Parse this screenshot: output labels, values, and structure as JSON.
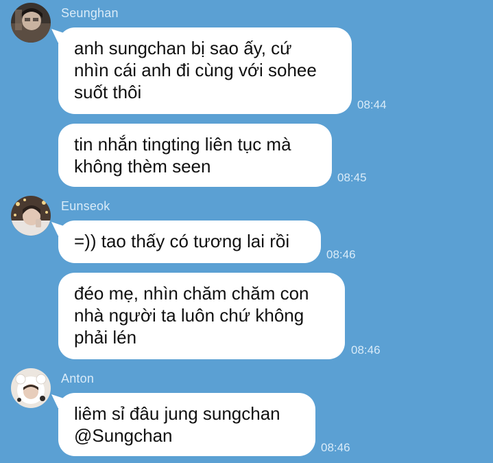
{
  "messages": [
    {
      "sender": "Seunghan",
      "avatar": "avatar-seunghan",
      "items": [
        {
          "lines": [
            "anh sungchan bị sao ấy, cứ",
            "nhìn cái anh đi cùng với sohee",
            "suốt thôi"
          ],
          "time": "08:44"
        },
        {
          "lines": [
            "tin nhắn tingting liên tục mà",
            "không thèm seen"
          ],
          "time": "08:45"
        }
      ]
    },
    {
      "sender": "Eunseok",
      "avatar": "avatar-eunseok",
      "items": [
        {
          "lines": [
            "=)) tao thấy có tương lai rồi"
          ],
          "time": "08:46"
        },
        {
          "lines": [
            "đéo mẹ, nhìn chăm chăm con",
            "nhà người ta luôn chứ không",
            "phải lén"
          ],
          "time": "08:46"
        }
      ]
    },
    {
      "sender": "Anton",
      "avatar": "avatar-anton",
      "items": [
        {
          "lines": [
            "liêm sỉ đâu jung sungchan",
            "@Sungchan"
          ],
          "time": "08:46"
        }
      ]
    }
  ]
}
